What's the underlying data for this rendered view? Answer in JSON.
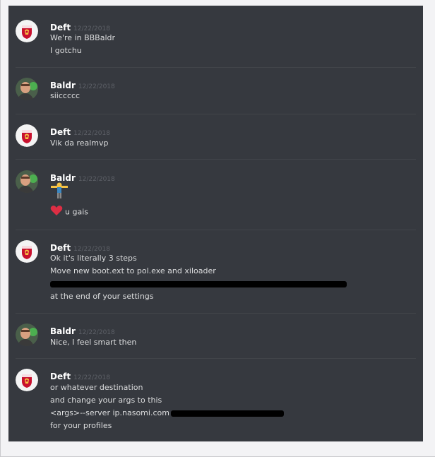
{
  "messages": [
    {
      "author": "Deft",
      "timestamp": "12/22/2018",
      "avatar_icon": "liverpool-crest-avatar",
      "lines": [
        "We're in BBBaldr",
        "I gotchu"
      ]
    },
    {
      "author": "Baldr",
      "timestamp": "12/22/2018",
      "avatar_icon": "photo-avatar",
      "lines": [
        "siiccccc"
      ]
    },
    {
      "author": "Deft",
      "timestamp": "12/22/2018",
      "avatar_icon": "liverpool-crest-avatar",
      "lines": [
        "Vik da realmvp"
      ]
    },
    {
      "author": "Baldr",
      "timestamp": "12/22/2018",
      "avatar_icon": "photo-avatar",
      "lines": [
        "",
        "u gais"
      ],
      "emoji": [
        "t-pose-figure-emoji",
        "heart-emoji"
      ]
    },
    {
      "author": "Deft",
      "timestamp": "12/22/2018",
      "avatar_icon": "liverpool-crest-avatar",
      "lines": [
        "Ok it's literally 3 steps",
        "Move new boot.ext to pol.exe and xiloader",
        "",
        "at the end of your settings"
      ],
      "redacted_line_index": 2
    },
    {
      "author": "Baldr",
      "timestamp": "12/22/2018",
      "avatar_icon": "photo-avatar",
      "lines": [
        "Nice, I feel smart then"
      ]
    },
    {
      "author": "Deft",
      "timestamp": "12/22/2018",
      "avatar_icon": "liverpool-crest-avatar",
      "lines": [
        "or whatever destination",
        "and change your args to this",
        "<args>--server ip.nasomi.com",
        "for your profiles"
      ],
      "partially_redacted_line_index": 2
    }
  ],
  "colors": {
    "background": "#36393f",
    "divider": "#42454a",
    "username": "#ffffff",
    "timestamp": "#5d6067",
    "message_text": "#dcddde",
    "liverpool_red": "#c8102e",
    "heart_red": "#dd2e44"
  }
}
